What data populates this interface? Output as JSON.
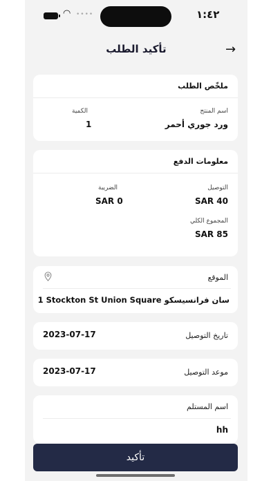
{
  "status": {
    "time": "١:٤٢",
    "wifi": "◠",
    "signal": "••••"
  },
  "header": {
    "title": "تأكيد الطلب",
    "back_icon": "arrow-right-icon"
  },
  "summary": {
    "title": "ملخّص الطلب",
    "product_label": "اسم المنتج",
    "product_value": "ورد جوري أحمر",
    "qty_label": "الكمية",
    "qty_value": "1"
  },
  "payment": {
    "title": "معلومات الدفع",
    "delivery_label": "التوصيل",
    "delivery_value": "SAR 40",
    "tax_label": "الضريبة",
    "tax_value": "SAR 0",
    "total_label": "المجموع الكلي",
    "total_value": "SAR 85"
  },
  "location": {
    "label": "الموقع",
    "value": "1 Stockton St Union Square سان فرانسيسكو",
    "icon": "location-pin-icon"
  },
  "delivery_date": {
    "label": "تاريخ التوصيل",
    "value": "2023-07-17"
  },
  "delivery_time": {
    "label": "موعد التوصيل",
    "value": "2023-07-17"
  },
  "recipient": {
    "label": "اسم المستلم",
    "value": "hh"
  },
  "confirm_label": "تأكيد",
  "colors": {
    "button": "#232a46",
    "background": "#f3f3f3"
  }
}
